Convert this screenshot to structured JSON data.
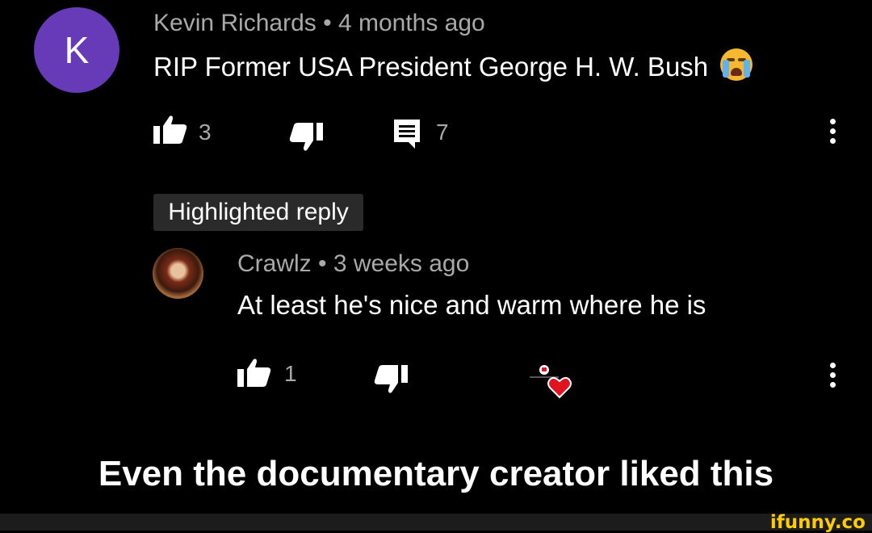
{
  "comment": {
    "avatar_letter": "K",
    "author": "Kevin Richards",
    "time": "4 months ago",
    "text": "RIP Former USA President George H. W. Bush",
    "emoji": "loudly-crying-face",
    "likes": "3",
    "replies": "7"
  },
  "highlight_label": "Highlighted reply",
  "reply": {
    "author": "Crawlz",
    "time": "3 weeks ago",
    "text": "At least he's nice and warm where he is",
    "likes": "1"
  },
  "caption": "Even the documentary creator liked this",
  "watermark": "ifunny.co",
  "colors": {
    "avatar": "#673ab7",
    "heart": "#e0141e",
    "watermark": "#ffcc00"
  }
}
